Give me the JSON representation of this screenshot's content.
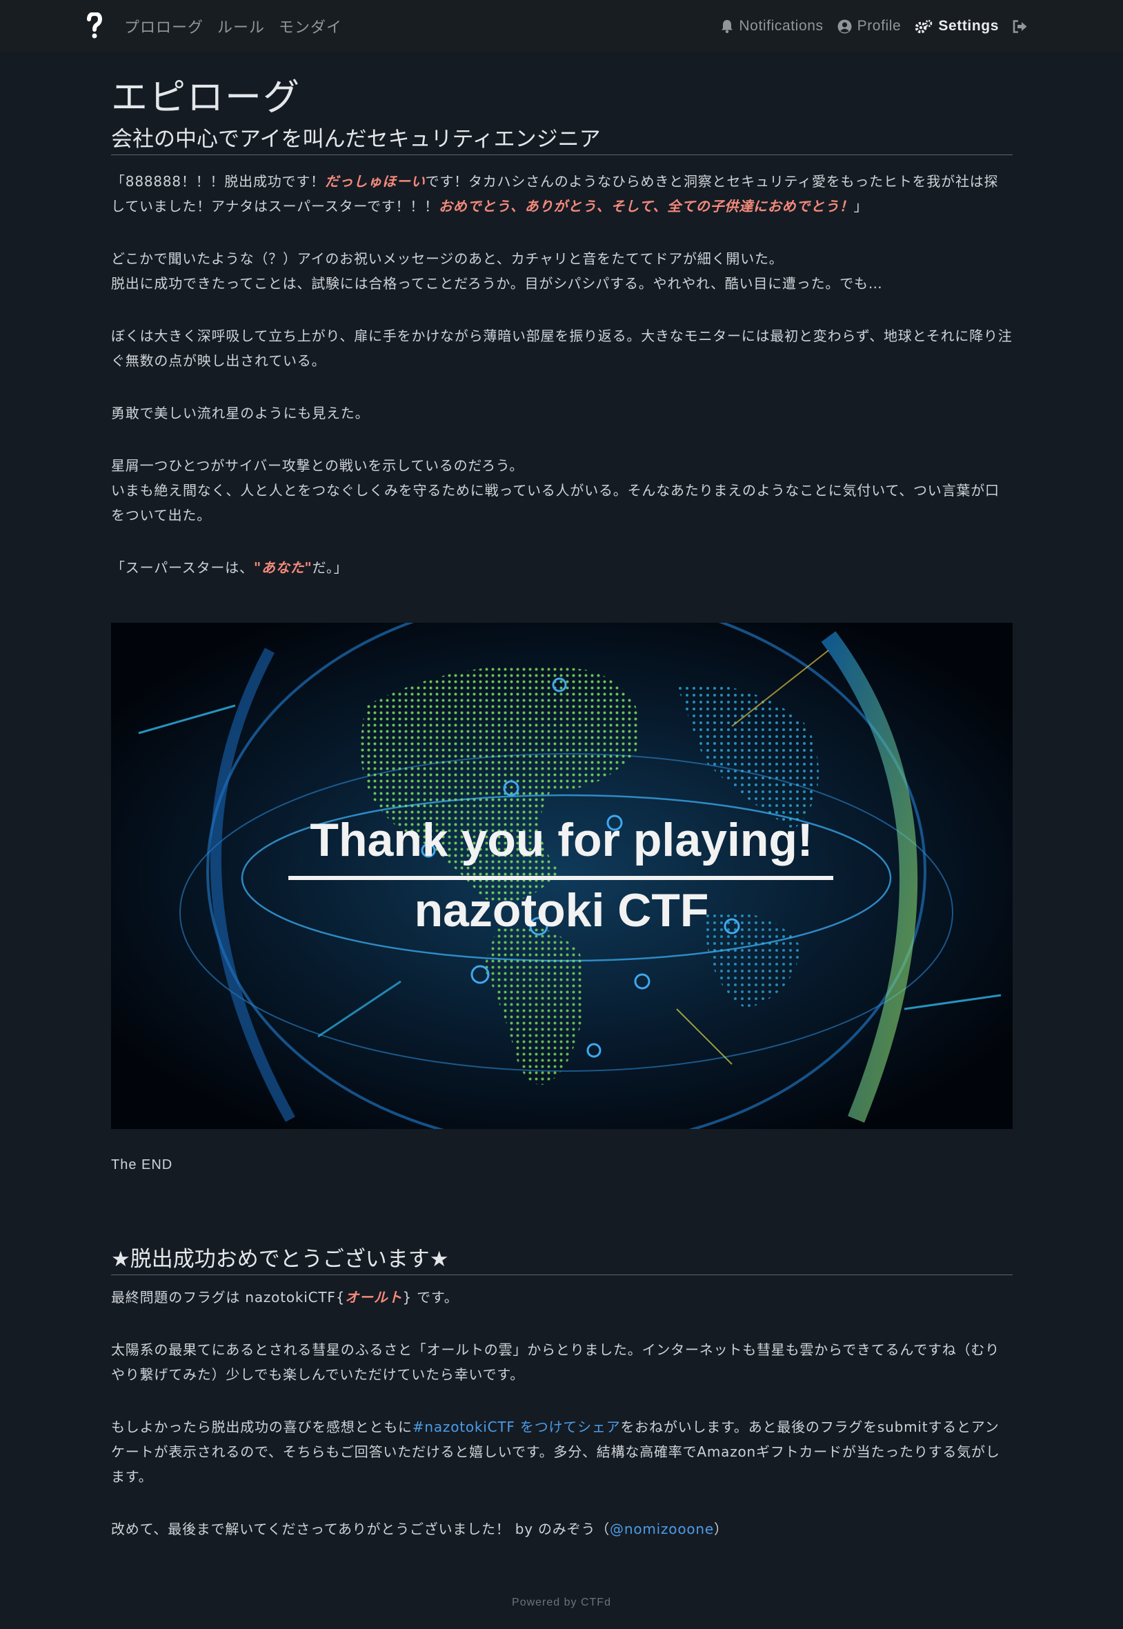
{
  "nav": {
    "left_items": [
      {
        "label": "プロローグ"
      },
      {
        "label": "ルール"
      },
      {
        "label": "モンダイ"
      }
    ],
    "right_items": [
      {
        "label": "Notifications",
        "icon": "bell-icon"
      },
      {
        "label": "Profile",
        "icon": "user-circle-icon"
      },
      {
        "label": "Settings",
        "icon": "gears-icon"
      },
      {
        "label": "",
        "icon": "logout-icon"
      }
    ]
  },
  "page": {
    "title": "エピローグ",
    "section1_title": "会社の中心でアイを叫んだセキュリティエンジニア",
    "p1": {
      "a": "「888888！！！脱出成功です！",
      "b": "だっしゅほーい",
      "c": "です！タカハシさんのようなひらめきと洞察とセキュリティ愛をもったヒトを我が社は探していました！アナタはスーパースターです！！！",
      "d": "おめでとう、ありがとう、そして、全ての子供達におめでとう！",
      "e": "」"
    },
    "p2_line1": "どこかで聞いたような（？）アイのお祝いメッセージのあと、カチャリと音をたててドアが細く開いた。",
    "p2_line2": "脱出に成功できたってことは、試験には合格ってことだろうか。目がシパシパする。やれやれ、酷い目に遭った。でも…",
    "p3": "ぼくは大きく深呼吸して立ち上がり、扉に手をかけながら薄暗い部屋を振り返る。大きなモニターには最初と変わらず、地球とそれに降り注ぐ無数の点が映し出されている。",
    "p4": "勇敢で美しい流れ星のようにも見えた。",
    "p5_line1": "星屑一つひとつがサイバー攻撃との戦いを示しているのだろう。",
    "p5_line2": "いまも絶え間なく、人と人とをつなぐしくみを守るために戦っている人がいる。そんなあたりまえのようなことに気付いて、つい言葉が口をついて出た。",
    "p6": {
      "a": "「スーパースターは、",
      "b": "\"あなた\"",
      "c": "だ。」"
    },
    "image": {
      "line1": "Thank you for playing!",
      "line2": "nazotoki CTF"
    },
    "the_end": "The END",
    "section2_title": "★脱出成功おめでとうございます★",
    "q1": {
      "a": "最終問題のフラグは nazotokiCTF{",
      "b": "オールト",
      "c": "} です。"
    },
    "q2": "太陽系の最果てにあるとされる彗星のふるさと「オールトの雲」からとりました。インターネットも彗星も雲からできてるんですね（むりやり繋げてみた）少しでも楽しんでいただけていたら幸いです。",
    "q3": {
      "a": "もしよかったら脱出成功の喜びを感想とともに",
      "link": "#nazotokiCTF をつけてシェア",
      "b": "をおねがいします。あと最後のフラグをsubmitするとアンケートが表示されるので、そちらもご回答いただけると嬉しいです。多分、結構な高確率でAmazonギフトカードが当たったりする気がします。"
    },
    "q4": {
      "a": "改めて、最後まで解いてくださってありがとうございました！ by のみぞう（",
      "link": "@nomizooone",
      "b": "）"
    }
  },
  "footer": "Powered by CTFd",
  "colors": {
    "background": "#151b23",
    "navbar": "#181d21",
    "highlight": "#f58a7b",
    "link": "#4a9de8"
  }
}
